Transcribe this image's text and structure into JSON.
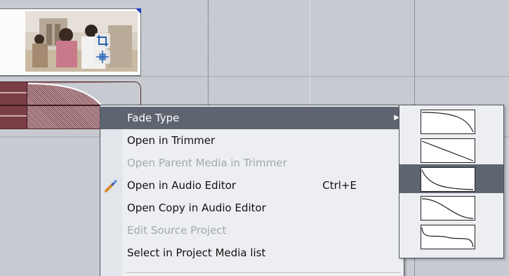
{
  "context_menu": {
    "items": [
      {
        "label": "Fade Type",
        "enabled": true,
        "highlighted": true,
        "has_submenu": true,
        "shortcut": ""
      },
      {
        "label": "Open in Trimmer",
        "enabled": true,
        "highlighted": false,
        "has_submenu": false,
        "shortcut": ""
      },
      {
        "label": "Open Parent Media in Trimmer",
        "enabled": false,
        "highlighted": false,
        "has_submenu": false,
        "shortcut": ""
      },
      {
        "label": "Open in Audio Editor",
        "enabled": true,
        "highlighted": false,
        "has_submenu": false,
        "shortcut": "Ctrl+E",
        "icon": "audio-editor-icon"
      },
      {
        "label": "Open Copy in Audio Editor",
        "enabled": true,
        "highlighted": false,
        "has_submenu": false,
        "shortcut": ""
      },
      {
        "label": "Edit Source Project",
        "enabled": false,
        "highlighted": false,
        "has_submenu": false,
        "shortcut": ""
      },
      {
        "label": "Select in Project Media list",
        "enabled": true,
        "highlighted": false,
        "has_submenu": false,
        "shortcut": ""
      }
    ],
    "submenu_arrow": "▶"
  },
  "fade_type_submenu": {
    "options": [
      {
        "name": "fast-fade-curve",
        "highlighted": false
      },
      {
        "name": "linear-fade-curve",
        "highlighted": false
      },
      {
        "name": "slow-fade-curve",
        "highlighted": true
      },
      {
        "name": "smooth-fade-curve",
        "highlighted": false
      },
      {
        "name": "sharp-fade-curve",
        "highlighted": false
      }
    ]
  },
  "colors": {
    "menu_highlight": "#5e6470",
    "audio_clip": "#7a3f47",
    "timeline_bg": "#c8ccd2"
  }
}
